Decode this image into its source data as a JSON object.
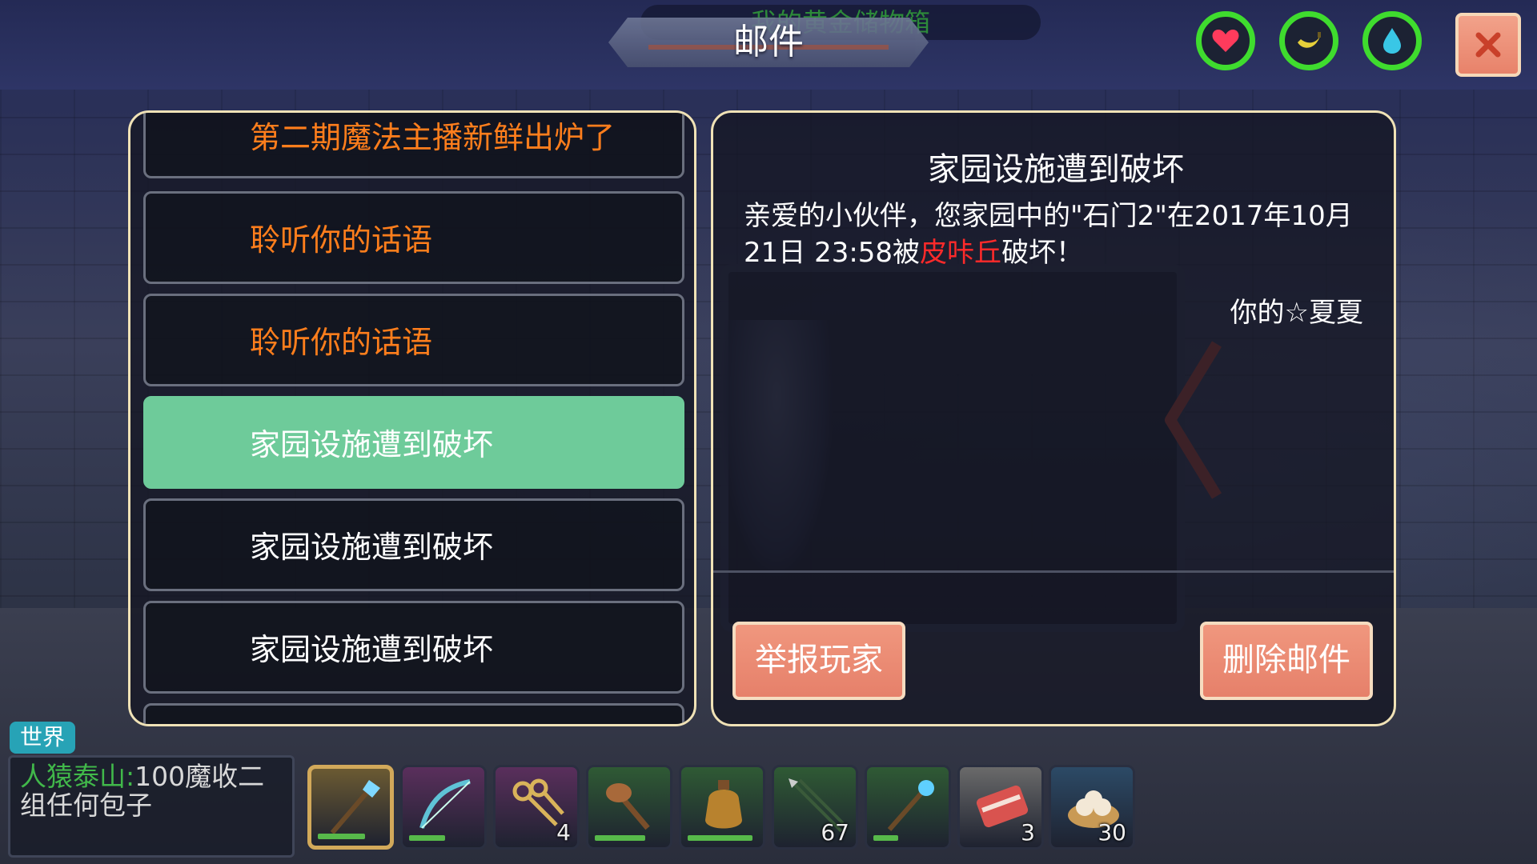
{
  "header": {
    "title": "邮件",
    "storage_hint": "我的黄金储物箱"
  },
  "status_icons": [
    {
      "name": "heart",
      "color": "#ff3b5c"
    },
    {
      "name": "banana",
      "color": "#e6cf3a"
    },
    {
      "name": "water-drop",
      "color": "#39c7e6"
    }
  ],
  "mail_list": [
    {
      "label": "第二期魔法主播新鲜出炉了",
      "state": "unread"
    },
    {
      "label": "聆听你的话语",
      "state": "unread"
    },
    {
      "label": "聆听你的话语",
      "state": "unread"
    },
    {
      "label": "家园设施遭到破坏",
      "state": "selected"
    },
    {
      "label": "家园设施遭到破坏",
      "state": "read"
    },
    {
      "label": "家园设施遭到破坏",
      "state": "read"
    }
  ],
  "mail_detail": {
    "title": "家园设施遭到破坏",
    "body_part1": "亲爱的小伙伴，您家园中的\"石门2\"在2017年10月21日 23:58被",
    "body_highlight": "皮咔丘",
    "body_part2": "破坏！",
    "signature": "你的☆夏夏",
    "report_button": "举报玩家",
    "delete_button": "删除邮件"
  },
  "chat": {
    "tab": "世界",
    "sender": "人猿泰山",
    "message": "100魔收二组任何包子"
  },
  "hotbar": [
    {
      "icon": "crystal-staff-icon",
      "count": "",
      "durability": 0.65,
      "bg": "#6b5a32"
    },
    {
      "icon": "crystal-bow-icon",
      "count": "",
      "durability": 0.5,
      "bg": "#5a2f5c"
    },
    {
      "icon": "keys-icon",
      "count": "4",
      "durability": null,
      "bg": "#5a2f5c"
    },
    {
      "icon": "wooden-club-icon",
      "count": "",
      "durability": 0.7,
      "bg": "#2f5a34"
    },
    {
      "icon": "water-bag-icon",
      "count": "",
      "durability": 0.9,
      "bg": "#2f5a34"
    },
    {
      "icon": "arrows-icon",
      "count": "67",
      "durability": null,
      "bg": "#2f5a34"
    },
    {
      "icon": "magic-wand-icon",
      "count": "",
      "durability": 0.35,
      "bg": "#2f5a34"
    },
    {
      "icon": "raw-meat-icon",
      "count": "3",
      "durability": null,
      "bg": "#6a6a6a"
    },
    {
      "icon": "steamed-buns-icon",
      "count": "30",
      "durability": null,
      "bg": "#2c4a66"
    }
  ]
}
